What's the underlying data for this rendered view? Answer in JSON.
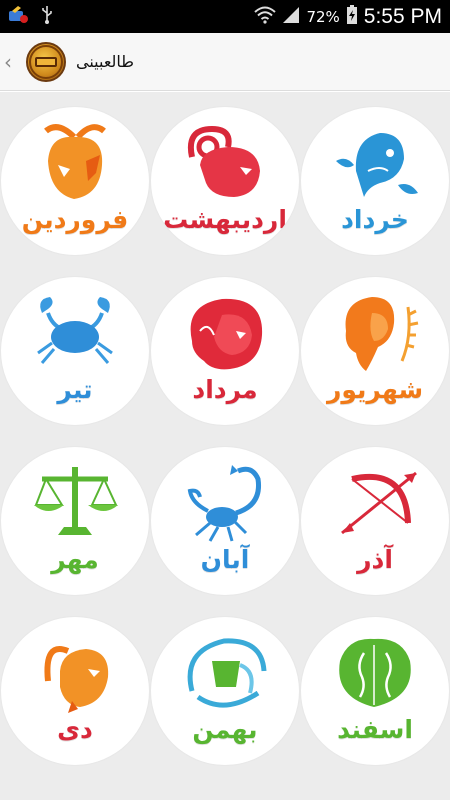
{
  "status_bar": {
    "battery_percent": "72%",
    "time": "5:55 PM"
  },
  "action_bar": {
    "title": "طالعبینی",
    "logo_text": "طالعبینی"
  },
  "signs": [
    {
      "name": "فروردین",
      "color": "#f07a18",
      "icon": "aries-ram-icon"
    },
    {
      "name": "اردیبهشت",
      "color": "#d8283a",
      "icon": "taurus-bull-icon"
    },
    {
      "name": "خرداد",
      "color": "#2a95d6",
      "icon": "gemini-fish-icon"
    },
    {
      "name": "تیر",
      "color": "#2f8ed8",
      "icon": "cancer-crab-icon"
    },
    {
      "name": "مرداد",
      "color": "#d8283a",
      "icon": "leo-lion-icon"
    },
    {
      "name": "شهریور",
      "color": "#f07a18",
      "icon": "virgo-maiden-icon"
    },
    {
      "name": "مهر",
      "color": "#58b531",
      "icon": "libra-scales-icon"
    },
    {
      "name": "آبان",
      "color": "#2f8ed8",
      "icon": "scorpio-scorpion-icon"
    },
    {
      "name": "آذر",
      "color": "#d8283a",
      "icon": "sagittarius-bow-icon"
    },
    {
      "name": "دی",
      "color": "#d8283a",
      "icon": "capricorn-goat-icon"
    },
    {
      "name": "بهمن",
      "color": "#58b531",
      "icon": "aquarius-water-icon"
    },
    {
      "name": "اسفند",
      "color": "#58b531",
      "icon": "pisces-twins-icon"
    }
  ]
}
